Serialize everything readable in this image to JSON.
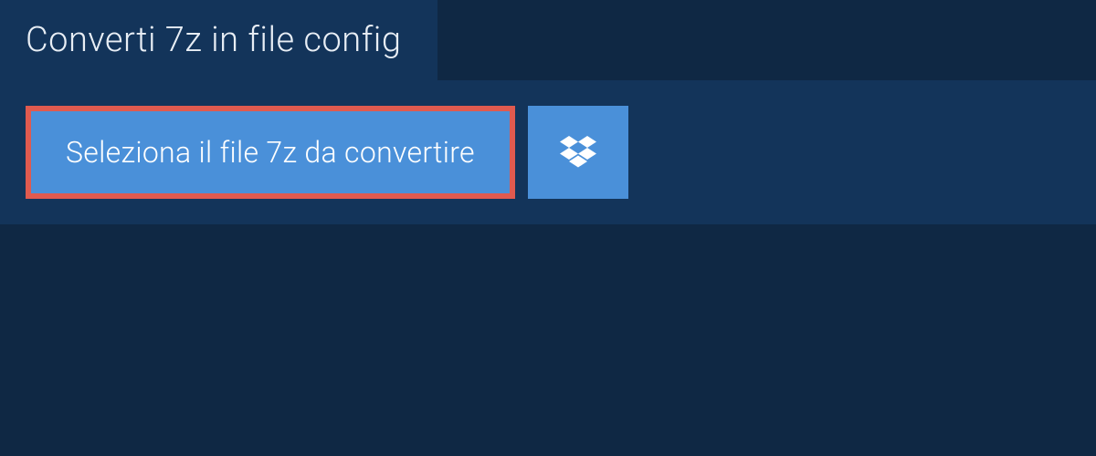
{
  "tab": {
    "title": "Converti 7z in file config"
  },
  "actions": {
    "select_file_label": "Seleziona il file 7z da convertire"
  },
  "colors": {
    "bg_dark": "#0f2844",
    "bg_panel": "#13345a",
    "button_blue": "#4a90d9",
    "highlight_red": "#e05a4f",
    "text_light": "#ffffff"
  }
}
